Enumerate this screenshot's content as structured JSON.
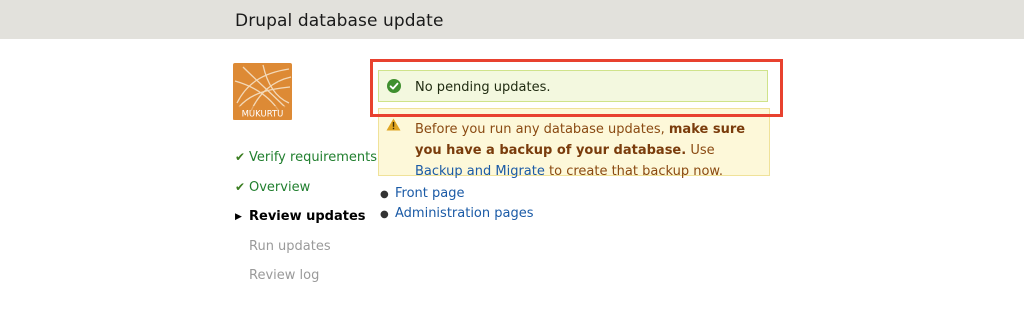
{
  "page": {
    "title": "Drupal database update"
  },
  "logo": {
    "text": "MUKURTU"
  },
  "steps": [
    {
      "label": "Verify requirements",
      "state": "done"
    },
    {
      "label": "Overview",
      "state": "done"
    },
    {
      "label": "Review updates",
      "state": "active"
    },
    {
      "label": "Run updates",
      "state": "todo"
    },
    {
      "label": "Review log",
      "state": "todo"
    }
  ],
  "status_message": {
    "text": "No pending updates.",
    "icon": "check-circle-icon"
  },
  "warning_message": {
    "icon": "warning-triangle-icon",
    "prefix": "Before you run any database updates, ",
    "bold": "make sure you have a backup of your database.",
    "middle": " Use ",
    "link": "Backup and Migrate",
    "suffix": " to create that backup now."
  },
  "links": [
    {
      "label": "Front page"
    },
    {
      "label": "Administration pages"
    }
  ],
  "colors": {
    "header_bg": "#e2e1dc",
    "logo_orange": "#dd8a35",
    "highlight_border": "#e8412f",
    "link": "#1a5aa6",
    "done_green": "#217f2f"
  }
}
